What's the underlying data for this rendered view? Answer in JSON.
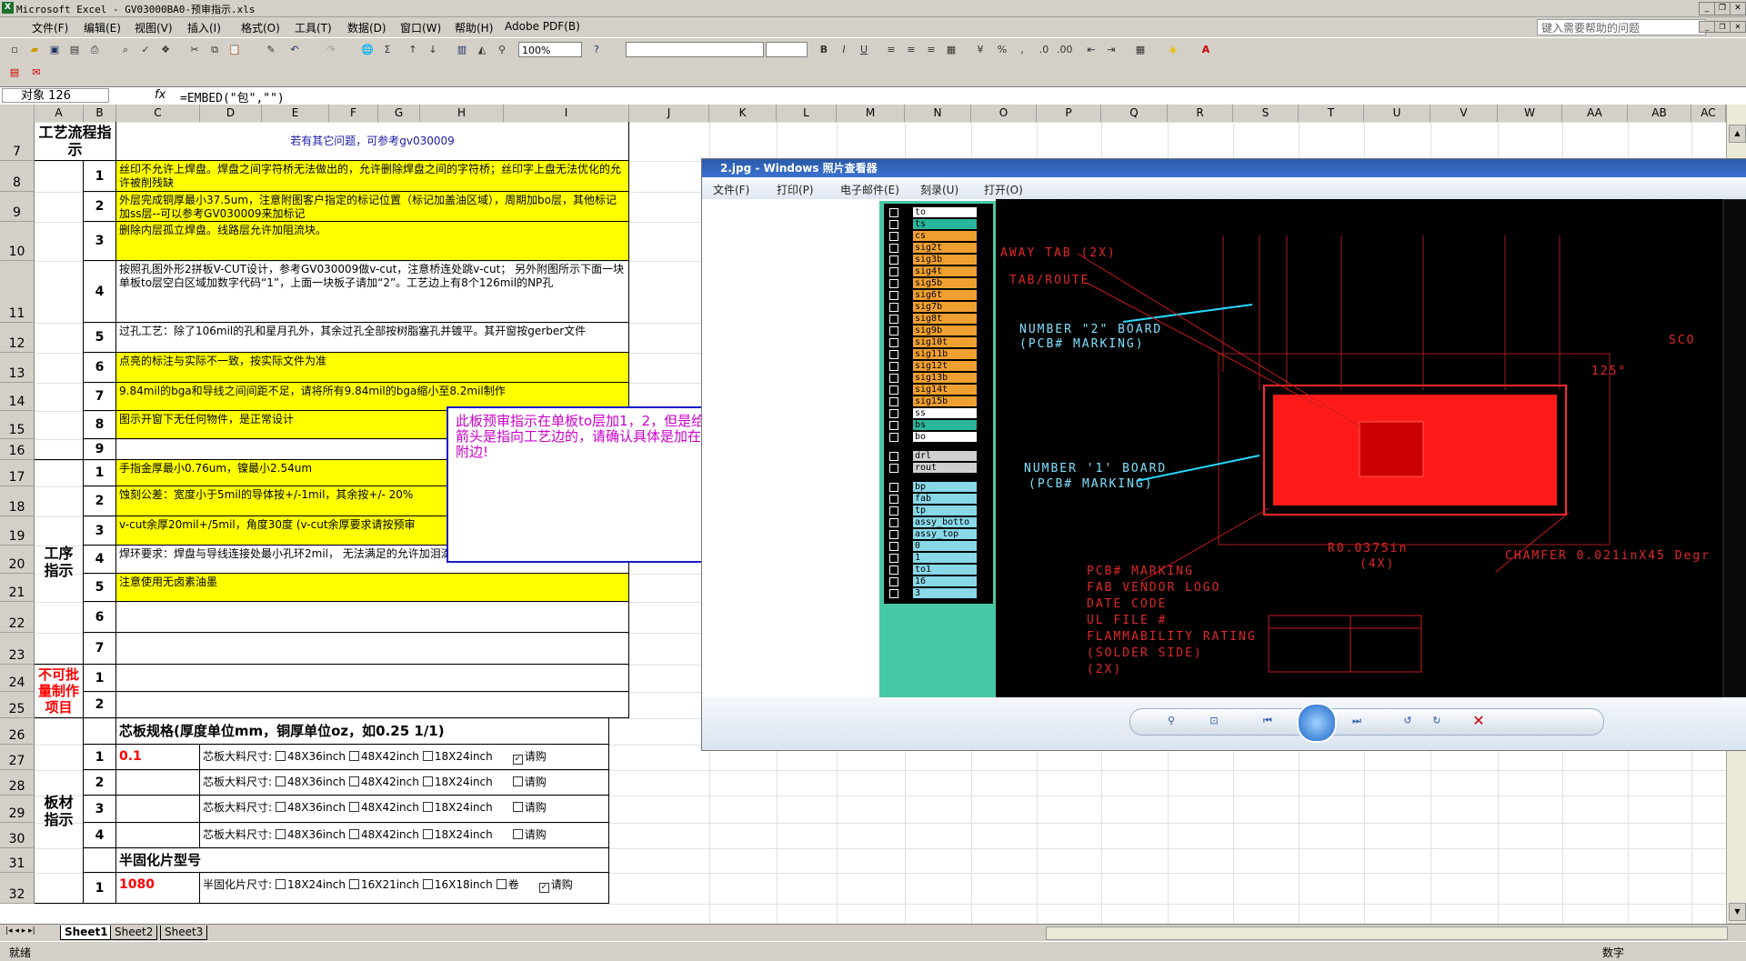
{
  "window": {
    "title": "Microsoft Excel - GV03000BA0-预审指示.xls",
    "help_placeholder": "键入需要帮助的问题"
  },
  "menu": [
    "文件(F)",
    "编辑(E)",
    "视图(V)",
    "插入(I)",
    "格式(O)",
    "工具(T)",
    "数据(D)",
    "窗口(W)",
    "帮助(H)",
    "Adobe PDF(B)"
  ],
  "toolbar": {
    "zoom": "100%"
  },
  "formula_bar": {
    "name_box": "对象 126",
    "fx": "fx",
    "formula": "=EMBED(\"包\",\"\")"
  },
  "columns": [
    "A",
    "B",
    "C",
    "D",
    "E",
    "F",
    "G",
    "H",
    "I",
    "J",
    "K",
    "L",
    "M",
    "N",
    "O",
    "P",
    "Q",
    "R",
    "S",
    "T",
    "U",
    "V",
    "W",
    "AA",
    "AB",
    "AC"
  ],
  "rows": [
    "7",
    "8",
    "9",
    "10",
    "11",
    "12",
    "13",
    "14",
    "15",
    "16",
    "17",
    "18",
    "19",
    "20",
    "21",
    "22",
    "23",
    "24",
    "25",
    "26",
    "27",
    "28",
    "29",
    "30",
    "31",
    "32"
  ],
  "sheet": {
    "process_flow_label": "工艺流程指示",
    "process_flow_note": "若有其它问题，可参考gv030009",
    "process_label": "工序指示",
    "not_batch_label": "不可批量制作项目",
    "material_label": "板材指示",
    "process_items": [
      {
        "n": "1",
        "text": "丝印不允许上焊盘。焊盘之间字符桥无法做出的，允许删除焊盘之间的字符桥；丝印字上盘无法优化的允许被削残缺",
        "yellow": true
      },
      {
        "n": "2",
        "text": "外层完成铜厚最小37.5um，注意附图客户指定的标记位置（标记加盖油区域），周期加bo层，其他标记加ss层--可以参考GV030009来加标记",
        "yellow": true
      },
      {
        "n": "3",
        "text": "删除内层孤立焊盘。线路层允许加阻流块。",
        "yellow": true
      },
      {
        "n": "4",
        "text": "按照孔图外形2拼板V-CUT设计，参考GV030009做v-cut，注意桥连处跳v-cut； 另外附图所示下面一块单板to层空白区域加数字代码“1”，上面一块板子请加“2”。工艺边上有8个126mil的NP孔",
        "yellow": false
      },
      {
        "n": "5",
        "text": "过孔工艺：除了106mil的孔和星月孔外，其余过孔全部按树脂塞孔并镀平。其开窗按gerber文件",
        "yellow": false
      },
      {
        "n": "6",
        "text": "点亮的标注与实际不一致，按实际文件为准",
        "yellow": true
      },
      {
        "n": "7",
        "text": "9.84mil的bga和导线之间间距不足，请将所有9.84mil的bga缩小至8.2mil制作",
        "yellow": true
      },
      {
        "n": "8",
        "text": "图示开窗下无任何物件，是正常设计",
        "yellow": true
      },
      {
        "n": "9",
        "text": "",
        "yellow": false
      }
    ],
    "work_items": [
      {
        "n": "1",
        "text": "手指金厚最小0.76um，镍最小2.54um",
        "yellow": true
      },
      {
        "n": "2",
        "text": "蚀刻公差：宽度小于5mil的导体按+/-1mil，其余按+/- 20%",
        "yellow": true
      },
      {
        "n": "3",
        "text": "v-cut余厚20mil+/5mil，角度30度 (v-cut余厚要求请按预审",
        "yellow": true
      },
      {
        "n": "4",
        "text": "焊环要求：焊盘与导线连接处最小孔环2mil， 无法满足的允许加泪滴或调整局部最小孔环2mil的要求",
        "yellow": false
      },
      {
        "n": "5",
        "text": "注意使用无卤素油墨",
        "yellow": true
      },
      {
        "n": "6",
        "text": "",
        "yellow": false
      },
      {
        "n": "7",
        "text": "",
        "yellow": false
      }
    ],
    "not_batch_items": [
      "1",
      "2"
    ],
    "core_spec_title": "芯板规格(厚度单位mm，铜厚单位oz，如0.25 1/1)",
    "core_rows": [
      {
        "n": "1",
        "value": "0.1",
        "label": "芯板大料尺寸:",
        "opts": [
          "48X36inch",
          "48X42inch",
          "18X24inch"
        ],
        "buy": "请购",
        "buy_checked": true
      },
      {
        "n": "2",
        "value": "",
        "label": "芯板大料尺寸:",
        "opts": [
          "48X36inch",
          "48X42inch",
          "18X24inch"
        ],
        "buy": "请购",
        "buy_checked": false
      },
      {
        "n": "3",
        "value": "",
        "label": "芯板大料尺寸:",
        "opts": [
          "48X36inch",
          "48X42inch",
          "18X24inch"
        ],
        "buy": "请购",
        "buy_checked": false
      },
      {
        "n": "4",
        "value": "",
        "label": "芯板大料尺寸:",
        "opts": [
          "48X36inch",
          "48X42inch",
          "18X24inch"
        ],
        "buy": "请购",
        "buy_checked": false
      }
    ],
    "prepreg_title": "半固化片型号",
    "prepreg_row": {
      "n": "1",
      "value": "1080",
      "label": "半固化片尺寸:",
      "opts": [
        "18X24inch",
        "16X21inch",
        "16X18inch"
      ],
      "roll": "卷",
      "buy": "请购",
      "buy_checked": true
    }
  },
  "comment": "此板预审指示在单板to层加1，2，但是给出的图纸箭头是指向工艺边的，请确认具体是加在单板还是附边!",
  "photo_viewer": {
    "title": "2.jpg - Windows 照片查看器",
    "menu": [
      "文件(F)",
      "打印(P)",
      "电子邮件(E)",
      "刻录(U)",
      "打开(O)"
    ],
    "layers_top": [
      "to",
      "ts",
      "cs",
      "sig2t",
      "sig3b",
      "sig4t",
      "sig5b",
      "sig6t",
      "sig7b",
      "sig8t",
      "sig9b",
      "sig10t",
      "sig11b",
      "sig12t",
      "sig13b",
      "sig14t",
      "sig15b",
      "ss",
      "bs",
      "bo"
    ],
    "layers_mid": [
      "drl",
      "rout"
    ],
    "layers_bottom": [
      "bp",
      "fab",
      "tp",
      "assy_botto",
      "assy_top",
      "0",
      "1",
      "to1",
      "16",
      "3"
    ],
    "cad_labels": {
      "away_tab": "AWAY TAB (2X)",
      "tab_route": "TAB/ROUTE",
      "number2": "NUMBER \"2\" BOARD",
      "number2b": "(PCB# MARKING)",
      "number1": "NUMBER '1' BOARD",
      "number1b": "(PCB# MARKING)",
      "radius": "R0.0375in",
      "radius_count": "(4X)",
      "chamfer": "CHAMFER 0.021inX45 Degr",
      "angle": "125°",
      "sco": "SCO",
      "notes": [
        "PCB# MARKING",
        "FAB VENDOR LOGO",
        "DATE CODE",
        "UL FILE #",
        "FLAMMABILITY RATING",
        "(SOLDER SIDE)",
        "(2X)"
      ]
    }
  },
  "tabs": [
    "Sheet1",
    "Sheet2",
    "Sheet3"
  ],
  "status": {
    "left": "就绪",
    "mode": "数字"
  },
  "colors": {
    "yellow": "#ffff00",
    "red": "#ff0000",
    "comment_border": "#1a1acc",
    "comment_text": "#cc00cc"
  }
}
